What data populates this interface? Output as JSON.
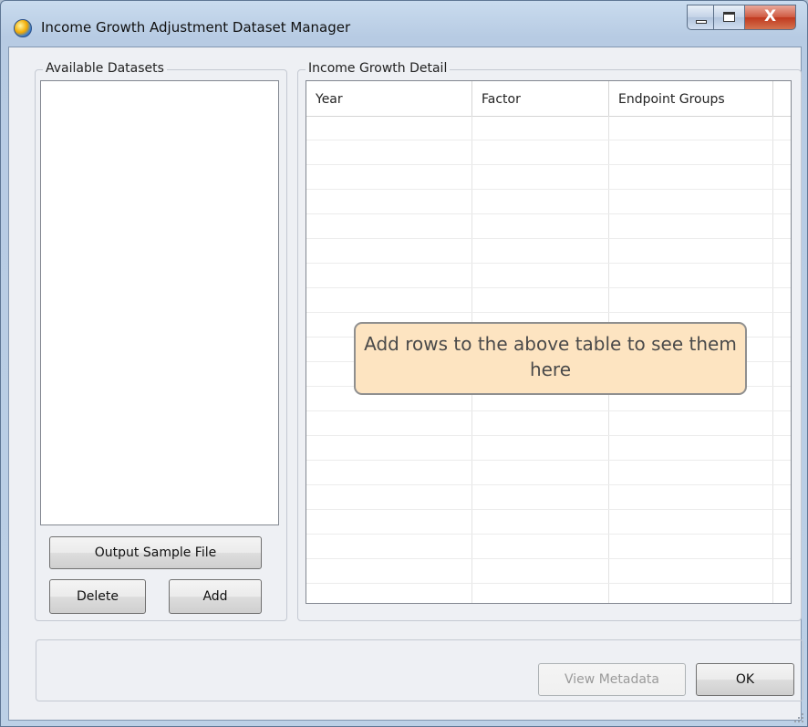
{
  "window": {
    "title": "Income Growth Adjustment Dataset Manager",
    "icon": "globe-app-icon",
    "controls": {
      "minimize": "minimize-icon",
      "maximize": "maximize-icon",
      "close": "close-icon",
      "close_glyph": "X"
    }
  },
  "datasets_panel": {
    "label": "Available Datasets",
    "items": [],
    "output_sample_label": "Output Sample File",
    "delete_label": "Delete",
    "add_label": "Add"
  },
  "detail_panel": {
    "label": "Income Growth Detail",
    "columns": [
      "Year",
      "Factor",
      "Endpoint Groups"
    ],
    "rows": [],
    "empty_hint": "Add rows to the above table to see them here"
  },
  "footer": {
    "view_metadata_label": "View Metadata",
    "ok_label": "OK"
  },
  "colors": {
    "hint_background": "#fde4c1",
    "close_button": "#c0391f"
  }
}
